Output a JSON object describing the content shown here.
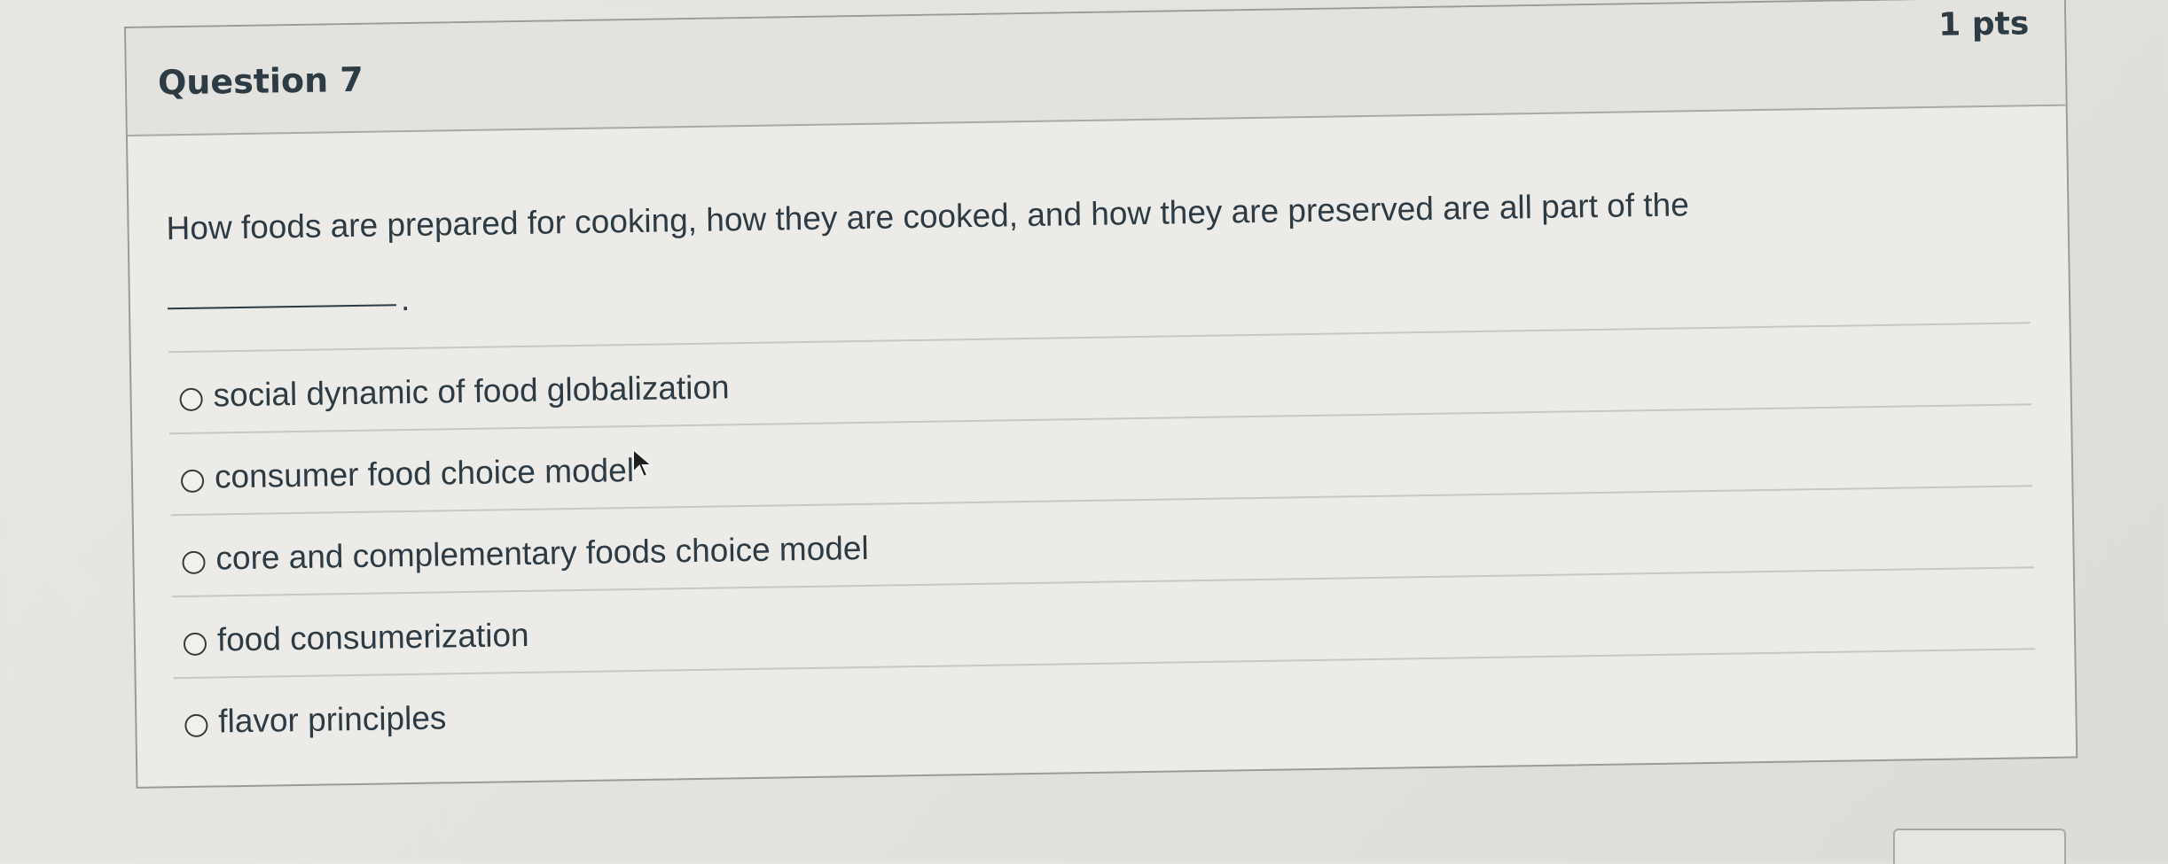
{
  "question": {
    "title": "Question 7",
    "points": "1 pts",
    "text": "How foods are prepared for cooking, how they are cooked, and how they are preserved are all part of the",
    "blank_suffix": "."
  },
  "answers": [
    {
      "label": "social dynamic of food globalization",
      "selected": false
    },
    {
      "label": "consumer food choice model",
      "selected": false
    },
    {
      "label": "core and complementary foods choice model",
      "selected": false
    },
    {
      "label": "food consumerization",
      "selected": false
    },
    {
      "label": "flavor principles",
      "selected": false
    }
  ],
  "icons": {
    "cursor": "mouse-pointer-icon",
    "radio": "radio-button-icon"
  },
  "colors": {
    "text": "#2d3b45",
    "card_background": "#ecebe7",
    "header_background": "#e3e2de",
    "border": "#9a9a9a"
  }
}
